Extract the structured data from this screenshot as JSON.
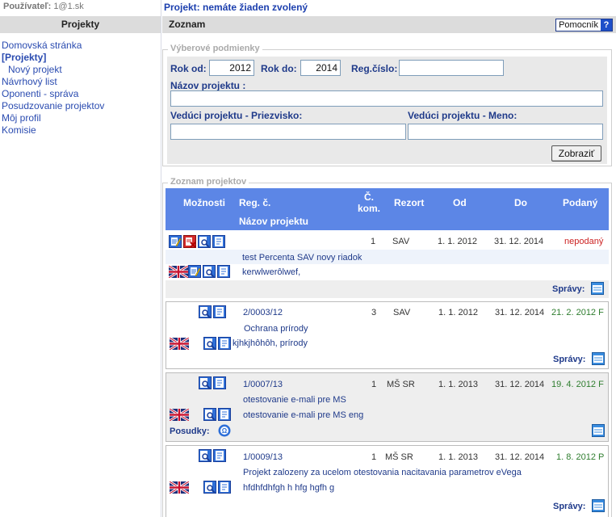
{
  "header": {
    "user_label": "Používateľ:",
    "user_value": "1@1.sk",
    "project_label": "Projekt:",
    "project_value": "nemáte žiaden zvolený"
  },
  "menu": {
    "title": "Projekty",
    "items": [
      {
        "label": "Domovská stránka"
      },
      {
        "label": "[Projekty]"
      },
      {
        "label": "Nový projekt"
      },
      {
        "label": "Návrhový list"
      },
      {
        "label": "Oponenti - správa"
      },
      {
        "label": "Posudzovanie projektov"
      },
      {
        "label": "Môj profil"
      },
      {
        "label": "Komisie"
      }
    ]
  },
  "main": {
    "title": "Zoznam",
    "help_label": "Pomocník",
    "help_icon": "?"
  },
  "filter": {
    "legend": "Výberové podmienky",
    "year_from_label": "Rok od:",
    "year_from_value": "2012",
    "year_to_label": "Rok do:",
    "year_to_value": "2014",
    "reg_label": "Reg.číslo:",
    "reg_value": "",
    "name_label": "Názov projektu :",
    "name_value": "",
    "lead_surname_label": "Vedúci projektu - Priezvisko:",
    "lead_surname_value": "",
    "lead_name_label": "Vedúci projektu - Meno:",
    "lead_name_value": "",
    "submit_label": "Zobraziť"
  },
  "list": {
    "legend": "Zoznam projektov",
    "headers": {
      "options": "Možnosti",
      "reg": "Reg. č.",
      "name": "Názov projektu",
      "kom_line1": "Č.",
      "kom_line2": "kom.",
      "rezort": "Rezort",
      "od": "Od",
      "do": "Do",
      "podany": "Podaný"
    },
    "spravy_label": "Správy:",
    "posudky_label": "Posudky:",
    "rows": [
      {
        "reg": "",
        "kom": "1",
        "rezort": "SAV",
        "od": "1. 1. 2012",
        "do": "31. 12. 2014",
        "podany": "nepodaný",
        "name_sk": "test Percenta SAV novy riadok",
        "name_en": "kerwlwerôlwef,"
      },
      {
        "reg": "2/0003/12",
        "kom": "3",
        "rezort": "SAV",
        "od": "1. 1. 2012",
        "do": "31. 12. 2014",
        "podany": "21. 2. 2012 F",
        "name_sk": "Ochrana prírody",
        "name_en": "kjhkjhôhôh, prírody"
      },
      {
        "reg": "1/0007/13",
        "kom": "1",
        "rezort": "MŠ SR",
        "od": "1. 1. 2013",
        "do": "31. 12. 2014",
        "podany": "19. 4. 2012 F",
        "name_sk": "otestovanie e-mali pre MS",
        "name_en": "otestovanie e-mali pre MS eng"
      },
      {
        "reg": "1/0009/13",
        "kom": "1",
        "rezort": "MŠ SR",
        "od": "1. 1. 2013",
        "do": "31. 12. 2014",
        "podany": "1. 8. 2012 P",
        "name_sk": "Projekt zalozeny za ucelom otestovania nacitavania parametrov eVega",
        "name_en": "hfdhfdhfgh h hfg hgfh g"
      }
    ]
  },
  "colors": {
    "header_blue": "#5c86e6",
    "link_blue": "#1f3a8a",
    "status_red": "#cc2222",
    "status_green": "#2e7d2e"
  },
  "icons": [
    "edit-icon",
    "delete-icon",
    "search-doc-icon",
    "report-icon",
    "uk-flag-icon",
    "messages-icon",
    "review-icon"
  ]
}
